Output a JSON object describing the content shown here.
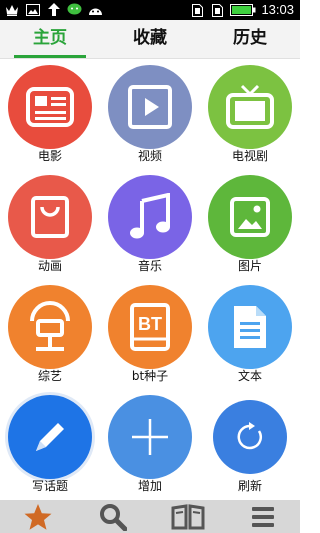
{
  "status_bar": {
    "time": "13:03",
    "icons": [
      "crown-icon",
      "image-icon",
      "upload-arrow-icon",
      "wechat-icon",
      "android-icon"
    ],
    "right_icons": [
      "sim-icon",
      "sim-icon",
      "battery-icon"
    ]
  },
  "tabs": [
    {
      "label": "主页",
      "active": true
    },
    {
      "label": "收藏",
      "active": false
    },
    {
      "label": "历史",
      "active": false
    }
  ],
  "grid": [
    {
      "label": "电影",
      "icon": "film-icon",
      "color": "#e84c3d"
    },
    {
      "label": "视频",
      "icon": "video-play-icon",
      "color": "#7e8fc2"
    },
    {
      "label": "电视剧",
      "icon": "tv-icon",
      "color": "#7cc241"
    },
    {
      "label": "动画",
      "icon": "shopping-bag-icon",
      "color": "#e8594a"
    },
    {
      "label": "音乐",
      "icon": "music-note-icon",
      "color": "#7a64e6"
    },
    {
      "label": "图片",
      "icon": "picture-icon",
      "color": "#5eb73b"
    },
    {
      "label": "综艺",
      "icon": "railway-sign-icon",
      "color": "#f0822e"
    },
    {
      "label": "bt种子",
      "icon": "bt-book-icon",
      "color": "#f0822e"
    },
    {
      "label": "文本",
      "icon": "document-icon",
      "color": "#4da4ef"
    },
    {
      "label": "写话题",
      "icon": "pencil-icon",
      "color": "#1e74e6"
    },
    {
      "label": "增加",
      "icon": "plus-icon",
      "color": "#4a90e2"
    },
    {
      "label": "刷新",
      "icon": "refresh-icon",
      "color": "#3a7fe0"
    }
  ],
  "bottom_bar": [
    {
      "icon": "star-icon",
      "color": "#d06a25"
    },
    {
      "icon": "search-icon",
      "color": "#555555"
    },
    {
      "icon": "book-icon",
      "color": "#555555"
    },
    {
      "icon": "menu-icon",
      "color": "#555555"
    }
  ],
  "colors": {
    "accent": "#2aa43a",
    "tab_bar_bg": "#f3f3f3",
    "bottom_bar_bg": "#d7d7d7"
  }
}
